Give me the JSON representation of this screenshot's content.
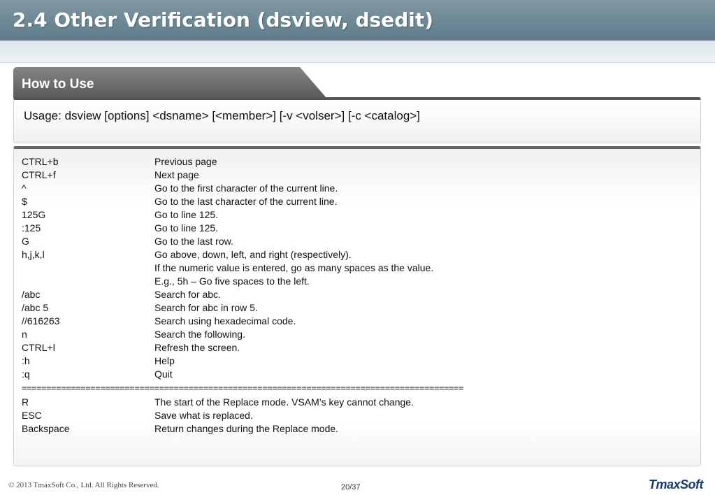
{
  "title": "2.4 Other Verification (dsview, dsedit)",
  "section_tab": "How to Use",
  "usage": "Usage: dsview [options] <dsname> [<member>] [-v <volser>] [-c <catalog>]",
  "commands": [
    {
      "key": "CTRL+b",
      "desc": "Previous page"
    },
    {
      "key": "CTRL+f",
      "desc": "Next page"
    },
    {
      "key": "^",
      "desc": "Go to the first character of the current line."
    },
    {
      "key": "$",
      "desc": "Go to the last character of the current line."
    },
    {
      "key": "125G",
      "desc": "Go to line 125."
    },
    {
      "key": ":125",
      "desc": "Go to line 125."
    },
    {
      "key": "G",
      "desc": "Go to the last row."
    },
    {
      "key": "h,j,k,l",
      "desc": "Go above, down, left, and right (respectively)."
    },
    {
      "key": "",
      "desc": "If the numeric value is entered, go as many spaces as the value."
    },
    {
      "key": "",
      "desc": "E.g., 5h – Go five spaces to the left."
    },
    {
      "key": "/abc",
      "desc": "Search for abc."
    },
    {
      "key": "/abc 5",
      "desc": "Search for abc in row 5."
    },
    {
      "key": "//616263",
      "desc": "Search using hexadecimal code."
    },
    {
      "key": "n",
      "desc": "Search the following."
    },
    {
      "key": "CTRL+l",
      "desc": "Refresh the screen."
    },
    {
      "key": ":h",
      "desc": "Help"
    },
    {
      "key": ":q",
      "desc": "Quit"
    }
  ],
  "separator": "==========================================================================================",
  "replace_commands": [
    {
      "key": "R",
      "desc": "The start of the Replace mode. VSAM’s key cannot change."
    },
    {
      "key": "ESC",
      "desc": "Save what is replaced."
    },
    {
      "key": "Backspace",
      "desc": "Return changes during the Replace mode."
    }
  ],
  "footer": {
    "copyright": "© 2013 TmaxSoft Co., Ltd. All Rights Reserved.",
    "page": "20/37",
    "logo": "TmaxSoft"
  },
  "colors": {
    "header": "#6d8896",
    "tab": "#6b6b6b",
    "logo": "#1a3a6e"
  }
}
